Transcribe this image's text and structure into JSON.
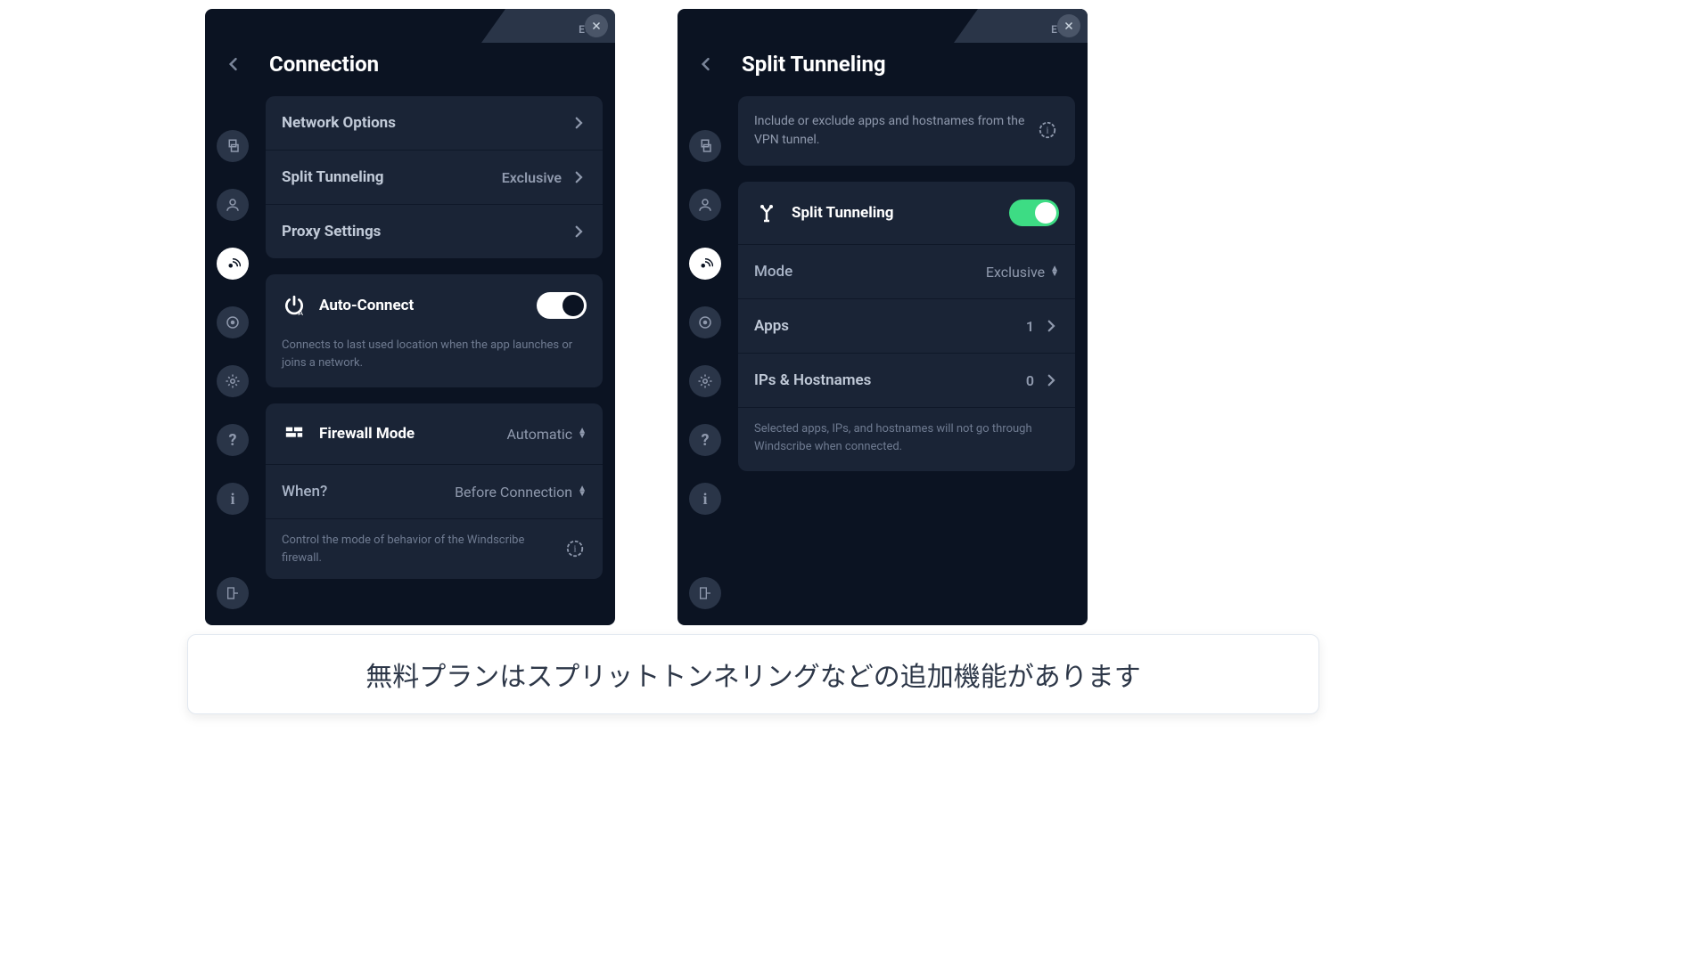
{
  "esc": "ESC",
  "panel1": {
    "title": "Connection",
    "rows": {
      "network": "Network Options",
      "split": "Split Tunneling",
      "split_value": "Exclusive",
      "proxy": "Proxy Settings"
    },
    "auto_connect": {
      "title": "Auto-Connect",
      "desc": "Connects to last used location when the app launches or joins a network."
    },
    "firewall": {
      "title": "Firewall Mode",
      "mode": "Automatic",
      "when_label": "When?",
      "when_value": "Before Connection",
      "desc": "Control the mode of behavior of the Windscribe firewall."
    }
  },
  "panel2": {
    "title": "Split Tunneling",
    "intro": "Include or exclude apps and hostnames from the VPN tunnel.",
    "toggle_label": "Split Tunneling",
    "mode_label": "Mode",
    "mode_value": "Exclusive",
    "apps_label": "Apps",
    "apps_count": "1",
    "ips_label": "IPs & Hostnames",
    "ips_count": "0",
    "footer": "Selected apps, IPs, and hostnames will not go through Windscribe when connected."
  },
  "caption": "無料プランはスプリットトンネリングなどの追加機能があります"
}
